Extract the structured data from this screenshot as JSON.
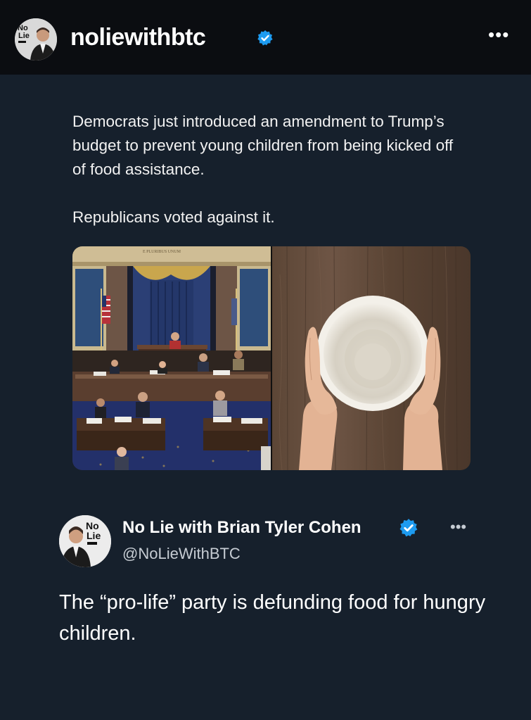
{
  "header": {
    "username": "noliewithbtc",
    "avatar_logo": "No Lie",
    "more_icon": "more-horizontal-icon"
  },
  "post": {
    "paragraphs": [
      "Democrats just introduced an amendment to Trump’s budget to prevent young children from being kicked off of food assistance.",
      "Republicans voted against it."
    ],
    "images": [
      "senate-chamber-photo",
      "empty-bowl-photo"
    ],
    "chamber_inscription": "E PLURIBUS UNUM"
  },
  "tweet": {
    "name": "No Lie with Brian Tyler Cohen",
    "handle": "@NoLieWithBTC",
    "avatar_logo": "No Lie",
    "text": "The “pro-life” party is defunding food for hungry children."
  },
  "colors": {
    "background": "#16202c",
    "header": "#0b0d11",
    "verified": "#1d9bf0"
  }
}
